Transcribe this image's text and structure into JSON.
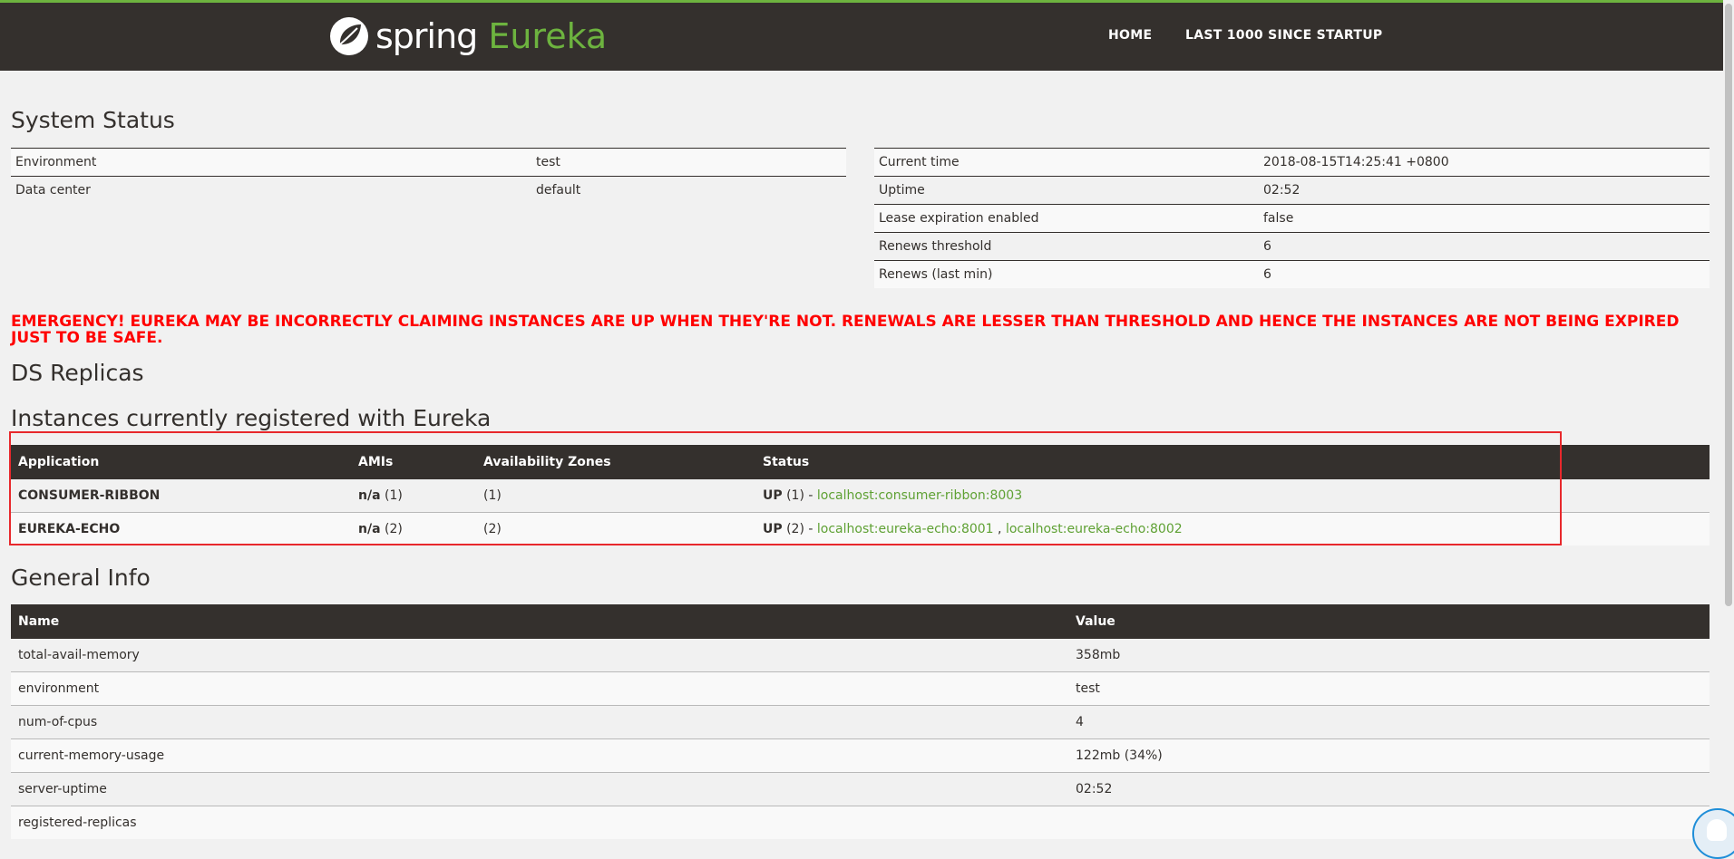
{
  "header": {
    "brand_word1": "spring",
    "brand_word2": "Eureka",
    "nav": {
      "home": "HOME",
      "last1000": "LAST 1000 SINCE STARTUP"
    }
  },
  "system_status": {
    "title": "System Status",
    "left": [
      {
        "key": "Environment",
        "value": "test"
      },
      {
        "key": "Data center",
        "value": "default"
      }
    ],
    "right": [
      {
        "key": "Current time",
        "value": "2018-08-15T14:25:41 +0800"
      },
      {
        "key": "Uptime",
        "value": "02:52"
      },
      {
        "key": "Lease expiration enabled",
        "value": "false"
      },
      {
        "key": "Renews threshold",
        "value": "6"
      },
      {
        "key": "Renews (last min)",
        "value": "6"
      }
    ]
  },
  "emergency": "EMERGENCY! EUREKA MAY BE INCORRECTLY CLAIMING INSTANCES ARE UP WHEN THEY'RE NOT. RENEWALS ARE LESSER THAN THRESHOLD AND HENCE THE INSTANCES ARE NOT BEING EXPIRED JUST TO BE SAFE.",
  "ds_replicas": {
    "title": "DS Replicas"
  },
  "instances": {
    "title": "Instances currently registered with Eureka",
    "columns": [
      "Application",
      "AMIs",
      "Availability Zones",
      "Status"
    ],
    "rows": [
      {
        "application": "CONSUMER-RIBBON",
        "ami": "n/a",
        "ami_count": "(1)",
        "zones": "(1)",
        "status": "UP",
        "status_count": "(1) -",
        "link1": "localhost:consumer-ribbon:8003",
        "separator": "",
        "link2": ""
      },
      {
        "application": "EUREKA-ECHO",
        "ami": "n/a",
        "ami_count": "(2)",
        "zones": "(2)",
        "status": "UP",
        "status_count": "(2) -",
        "link1": "localhost:eureka-echo:8001",
        "separator": ",",
        "link2": "localhost:eureka-echo:8002"
      }
    ]
  },
  "general_info": {
    "title": "General Info",
    "columns": [
      "Name",
      "Value"
    ],
    "rows": [
      {
        "name": "total-avail-memory",
        "value": "358mb"
      },
      {
        "name": "environment",
        "value": "test"
      },
      {
        "name": "num-of-cpus",
        "value": "4"
      },
      {
        "name": "current-memory-usage",
        "value": "122mb (34%)"
      },
      {
        "name": "server-uptime",
        "value": "02:52"
      },
      {
        "name": "registered-replicas",
        "value": ""
      }
    ]
  },
  "colors": {
    "brand_green": "#6db33f",
    "header_bg": "#34302d",
    "emergency_red": "#ff0000",
    "highlight_box": "#e8282c"
  }
}
